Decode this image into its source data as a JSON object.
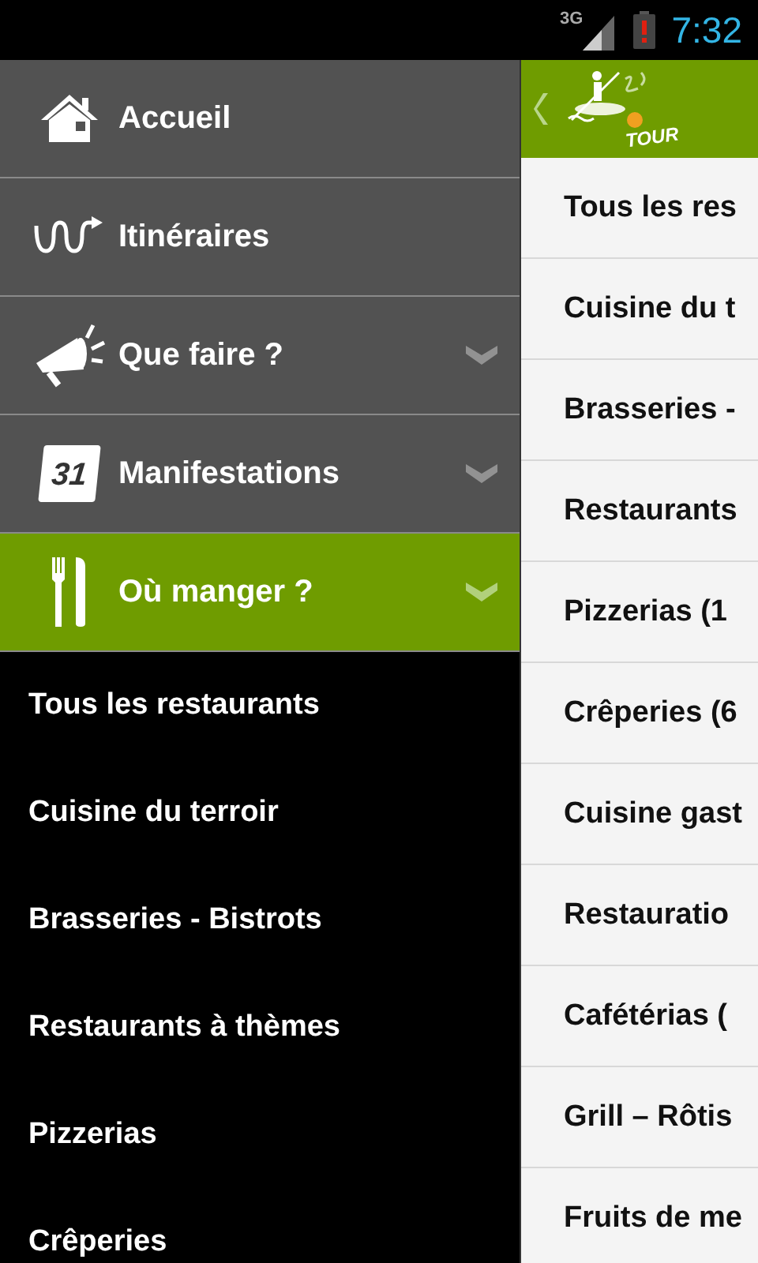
{
  "status_bar": {
    "network": "3G",
    "time": "7:32"
  },
  "drawer": {
    "items": [
      {
        "label": "Accueil",
        "kind": "house",
        "selected": false,
        "expandable": false
      },
      {
        "label": "Itinéraires",
        "kind": "route",
        "selected": false,
        "expandable": false
      },
      {
        "label": "Que faire ?",
        "kind": "megaphone",
        "selected": false,
        "expandable": true
      },
      {
        "label": "Manifestations",
        "kind": "calendar",
        "icon_text": "31",
        "selected": false,
        "expandable": true
      },
      {
        "label": "Où manger ?",
        "kind": "cutlery",
        "selected": true,
        "expandable": true,
        "children": [
          {
            "label": "Tous les restaurants"
          },
          {
            "label": "Cuisine du terroir"
          },
          {
            "label": "Brasseries - Bistrots"
          },
          {
            "label": "Restaurants à thèmes"
          },
          {
            "label": "Pizzerias"
          },
          {
            "label": "Crêperies"
          }
        ]
      }
    ]
  },
  "app_bar": {
    "logo_text": "TOUR"
  },
  "list": [
    "Tous les res",
    "Cuisine du t",
    "Brasseries -",
    "Restaurants",
    "Pizzerias (1",
    "Crêperies (6",
    "Cuisine gast",
    "Restauratio",
    "Cafétérias (",
    "Grill – Rôtis",
    "Fruits de me"
  ]
}
